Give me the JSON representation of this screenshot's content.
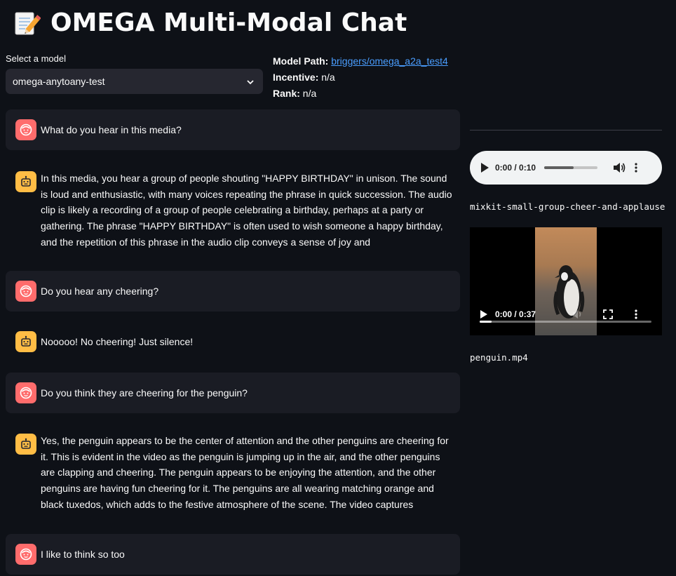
{
  "app": {
    "title": "OMEGA Multi-Modal Chat",
    "title_icon": "memo-pencil-icon"
  },
  "model_select": {
    "label": "Select a model",
    "value": "omega-anytoany-test"
  },
  "model_info": {
    "path_label": "Model Path:",
    "path_value": "briggers/omega_a2a_test4",
    "incentive_label": "Incentive:",
    "incentive_value": "n/a",
    "rank_label": "Rank:",
    "rank_value": "n/a"
  },
  "messages": [
    {
      "role": "user",
      "text": "What do you hear in this media?"
    },
    {
      "role": "assistant",
      "text": "In this media, you hear a group of people shouting \"HAPPY BIRTHDAY\" in unison. The sound is loud and enthusiastic, with many voices repeating the phrase in quick succession. The audio clip is likely a recording of a group of people celebrating a birthday, perhaps at a party or gathering. The phrase \"HAPPY BIRTHDAY\" is often used to wish someone a happy birthday, and the repetition of this phrase in the audio clip conveys a sense of joy and"
    },
    {
      "role": "user",
      "text": "Do you hear any cheering?"
    },
    {
      "role": "assistant",
      "text": "Nooooo! No cheering! Just silence!"
    },
    {
      "role": "user",
      "text": "Do you think they are cheering for the penguin?"
    },
    {
      "role": "assistant",
      "text": "Yes, the penguin appears to be the center of attention and the other penguins are cheering for it. This is evident in the video as the penguin is jumping up in the air, and the other penguins are clapping and cheering. The penguin appears to be enjoying the attention, and the other penguins are having fun cheering for it. The penguins are all wearing matching orange and black tuxedos, which adds to the festive atmosphere of the scene. The video captures"
    },
    {
      "role": "user",
      "text": "I like to think so too"
    }
  ],
  "audio_player": {
    "time": "0:00 / 0:10",
    "progress": 0.55,
    "filename": "mixkit-small-group-cheer-and-applause"
  },
  "video_player": {
    "time": "0:00 / 0:37",
    "progress": 0.07,
    "filename": "penguin.mp4"
  },
  "colors": {
    "background": "#0e1117",
    "user_avatar": "#ff6c6c",
    "bot_avatar": "#ffbd45",
    "link": "#4a9eff",
    "user_row": "#1a1c24"
  }
}
